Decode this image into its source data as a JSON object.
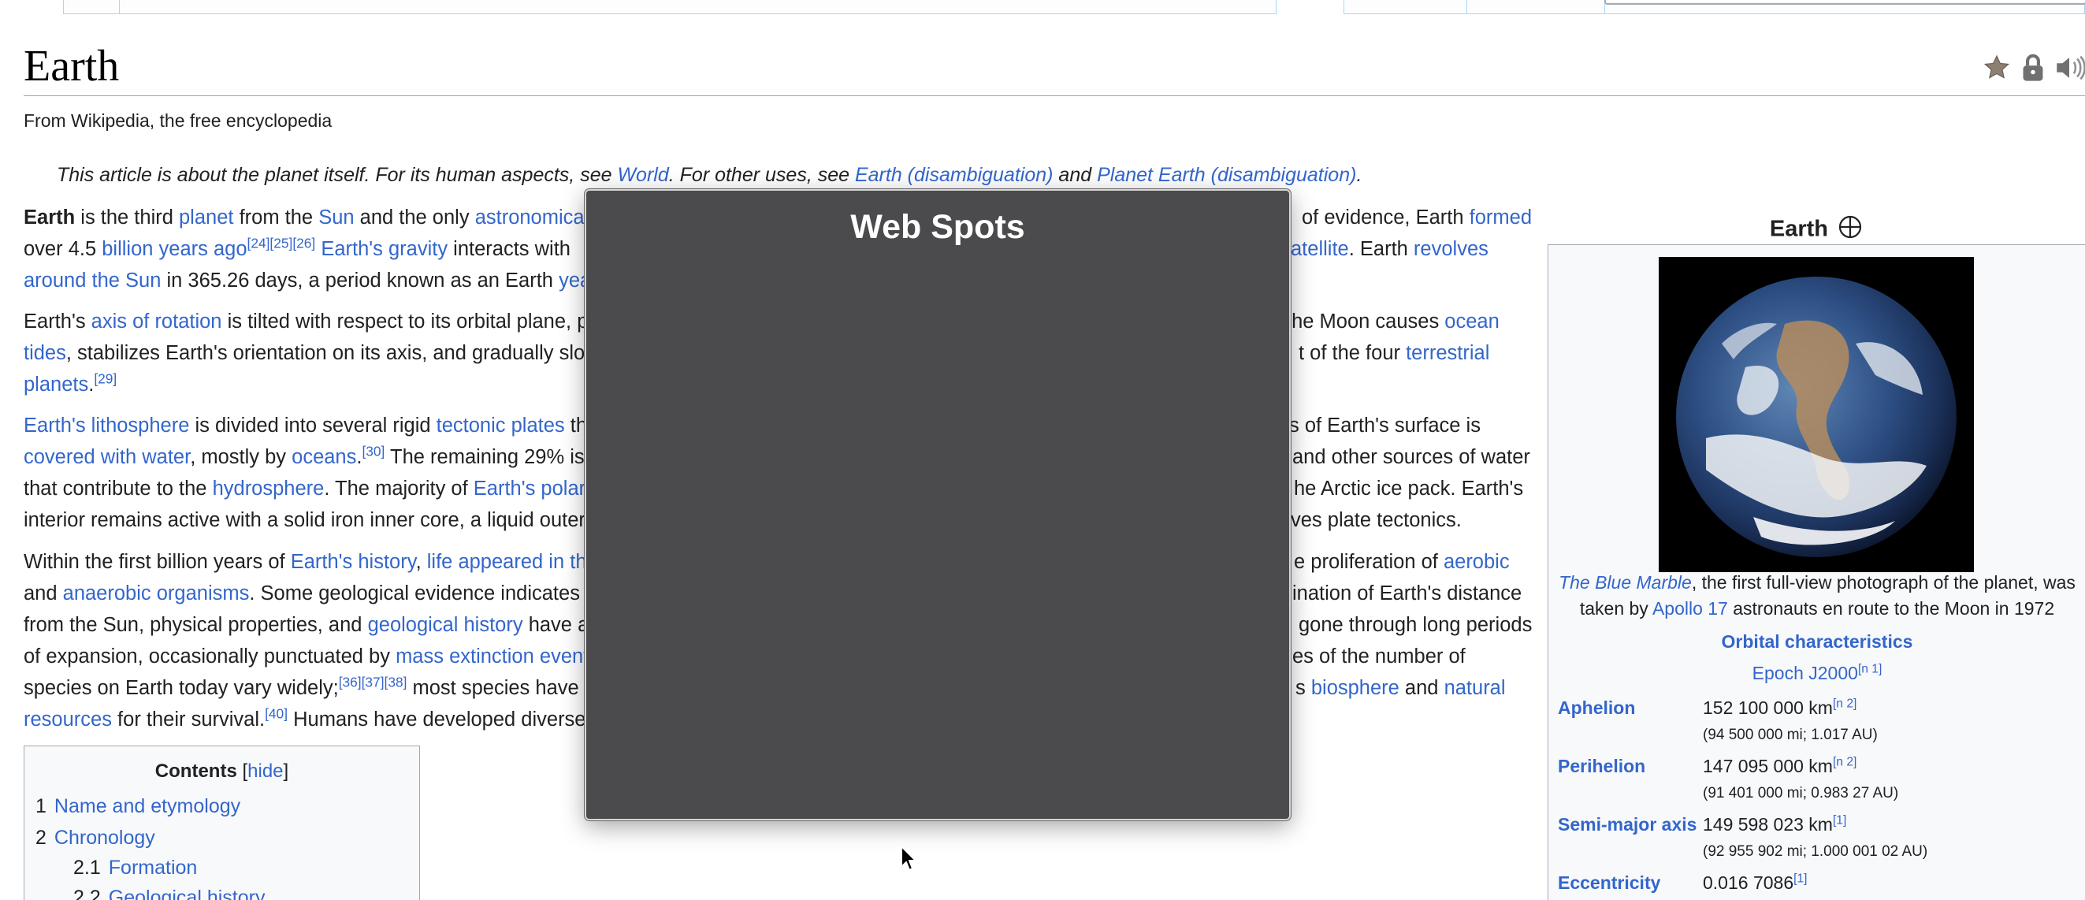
{
  "page": {
    "title": "Earth",
    "tagline": "From Wikipedia, the free encyclopedia",
    "hatnote": {
      "t1": "This article is about the planet itself. For its human aspects, see ",
      "l1": "World",
      "t2": ". For other uses, see ",
      "l2": "Earth (disambiguation)",
      "t3": " and ",
      "l3": "Planet Earth (disambiguation)",
      "t4": "."
    }
  },
  "title_icons": [
    "star-icon",
    "lock-icon",
    "speaker-icon"
  ],
  "paragraphs": {
    "p1": {
      "l1a_bold": "Earth",
      "l1a": " is the third ",
      "l1b": "planet",
      "l1c": " from the ",
      "l1d": "Sun",
      "l1e": " and the only ",
      "l1f": "astronomical",
      "l1g": "of evidence, Earth ",
      "l1h": "formed",
      "l2a": "over 4.5 ",
      "l2b": "billion years ago",
      "l2c": "[24][25][26]",
      "l2d": "Earth's gravity",
      "l2e": " interacts with",
      "l2f": "atellite",
      "l2g": ". Earth ",
      "l2h": "revolves",
      "l3a": "around the Sun",
      "l3b": " in 365.26 days, a period known as an Earth ",
      "l3c": "yea"
    },
    "p2": {
      "l1a": "Earth's ",
      "l1b": "axis of rotation",
      "l1c": " is tilted with respect to its orbital plane, p",
      "l1d": "the Moon causes ",
      "l1e": "ocean",
      "l2a": "tides",
      "l2b": ", stabilizes Earth's orientation on its axis, and gradually slo",
      "l2c": "t of the four ",
      "l2d": "terrestrial",
      "l3a": "planets",
      "l3b": ".",
      "l3c": "[29]"
    },
    "p3": {
      "l1a": "Earth's lithosphere",
      "l1b": " is divided into several rigid ",
      "l1c": "tectonic plates",
      "l1d": " th",
      "l1e": "s of Earth's surface is",
      "l2a": "covered with water",
      "l2b": ", mostly by ",
      "l2c": "oceans",
      "l2d": ".",
      "l2e": "[30]",
      "l2f": " The remaining 29% is",
      "l2g": "and other sources of water",
      "l3a": "that contribute to the ",
      "l3b": "hydrosphere",
      "l3c": ". The majority of ",
      "l3d": "Earth's polar",
      "l3e": "he Arctic ice pack. Earth's",
      "l4a": "interior remains active with a solid iron inner core, a liquid outer",
      "l4b": "ves plate tectonics."
    },
    "p4": {
      "l1a": "Within the first billion years of ",
      "l1b": "Earth's history",
      "l1c": ", ",
      "l1d": "life appeared in th",
      "l1e": "e proliferation of ",
      "l1f": "aerobic",
      "l2a": "and ",
      "l2b": "anaerobic organisms",
      "l2c": ". Some geological evidence indicates",
      "l2d": "ination of Earth's distance",
      "l3a": "from the Sun, physical properties, and ",
      "l3b": "geological history",
      "l3c": " have a",
      "l3d": "gone through long periods",
      "l4a": "of expansion, occasionally punctuated by ",
      "l4b": "mass extinction event",
      "l4c": "es of the number of",
      "l5a": "species on Earth today vary widely;",
      "l5b": "[36][37][38]",
      "l5c": " most species have",
      "l5d": "s ",
      "l5e": "biosphere",
      "l5f": " and ",
      "l5g": "natural",
      "l6a": "resources",
      "l6b": " for their survival.",
      "l6c": "[40]",
      "l6d": " Humans have developed diverse"
    }
  },
  "toc": {
    "title": "Contents",
    "hide_open": "[",
    "hide_label": "hide",
    "hide_close": "]",
    "items": [
      {
        "num": "1",
        "label": "Name and etymology"
      },
      {
        "num": "2",
        "label": "Chronology"
      },
      {
        "num": "2.1",
        "label": "Formation"
      },
      {
        "num": "2.2",
        "label": "Geological history"
      }
    ]
  },
  "infobox": {
    "title": "Earth",
    "title_icon": "circle-cross-icon",
    "caption_link1": "The Blue Marble",
    "caption_t1": ", the first full-view photograph of the planet, was",
    "caption_t2": "taken by ",
    "caption_link2": "Apollo 17",
    "caption_t3": " astronauts en route to the Moon in 1972",
    "section": "Orbital characteristics",
    "epoch": "Epoch J2000",
    "epoch_ref": "[n 1]",
    "rows": [
      {
        "label": "Aphelion",
        "value": "152 100 000 km",
        "ref": "[n 2]",
        "sub": "(94 500 000 mi; 1.017 AU)"
      },
      {
        "label": "Perihelion",
        "value": "147 095 000 km",
        "ref": "[n 2]",
        "sub": "(91 401 000 mi; 0.983 27 AU)"
      },
      {
        "label": "Semi-major axis",
        "value": "149 598 023 km",
        "ref": "[1]",
        "sub": "(92 955 902 mi; 1.000 001 02 AU)"
      },
      {
        "label": "Eccentricity",
        "value": "0.016 7086",
        "ref": "[1]",
        "sub": ""
      }
    ]
  },
  "modal": {
    "title": "Web Spots",
    "background": "#4b4b4d"
  },
  "colors": {
    "link": "#3366cc",
    "text": "#202122",
    "infobox_bg": "#f8f9fa"
  }
}
